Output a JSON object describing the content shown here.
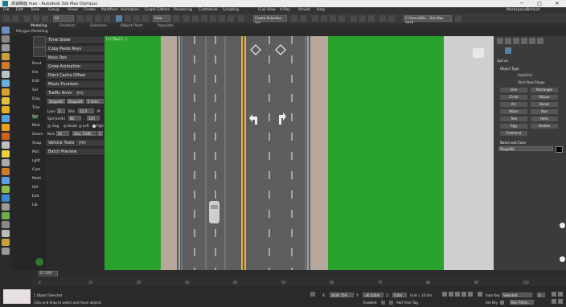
{
  "window": {
    "title": "高速路面.max - Autodesk 3ds Max Olympus",
    "min": "─",
    "max": "□",
    "close": "✕"
  },
  "menu": [
    "File",
    "Edit",
    "Tools",
    "Group",
    "Views",
    "Create",
    "Modifiers",
    "Animation",
    "Graph Editors",
    "Rendering",
    "Customize",
    "Scripting",
    "Civil View",
    "V-Ray",
    "Arnold",
    "Help"
  ],
  "workspaces": {
    "label": "Workspaces:",
    "value": "Default"
  },
  "toolbar": {
    "selection_filter": "All",
    "view_dropdown": "View",
    "selection_set": "Create Selection Set",
    "project_path": "C:\\Users\\Win...\\3ds Max 2018"
  },
  "ribbon_tabs": [
    "Modeling",
    "Freeform",
    "Selection",
    "Object Paint",
    "Populate"
  ],
  "ribbon_subtitle": "Polygon Modeling",
  "script_column": [
    "Rend",
    "File",
    "Edit",
    "Sel",
    "Disp",
    "Tran",
    "Spl",
    "Mod",
    "Geom",
    "Shap",
    "Mat",
    "Lght",
    "Cam",
    "Modl",
    "Util",
    "Extr",
    "Lib"
  ],
  "script_buttons": [
    "Time Slider",
    "Copy Paste Keys",
    "Keys Ops",
    "Grow Animation",
    "Point Cache Offset",
    "Music Fountain",
    "Traffic Anim"
  ],
  "traffic": {
    "suffix": "(m)",
    "shape_a": "Shape00",
    "shape_b": "Shape08",
    "vehicles": "0 Vehic",
    "lane_label": "Lane",
    "lane_value": "2",
    "wid_label": "Wid.",
    "wid_value": "12.0",
    "wid_unit": "M",
    "spd_label": "Spd (km/h)",
    "spd_min": "80",
    "spd_dash": "-",
    "spd_max": "120",
    "opt_gog": "Gog",
    "opt_double": "Doubl",
    "opt_left": "Left",
    "opt_right": "Righ",
    "num_label": "Num",
    "num_value": "20",
    "gen_traffic": "Gen. Traffic",
    "gen_x": "X"
  },
  "script_buttons_lower": [
    "Vehicle Trails",
    "Batch Preview"
  ],
  "vehicle_trails_suffix": "(m)",
  "viewport": {
    "label": "[+] [Top] [...]",
    "grass_color": "#29a32b",
    "asphalt_color": "#5e5e5e",
    "shoulder_color": "#b5a79b",
    "center_line_color": "#e3b33a"
  },
  "command_panel": {
    "category": "Splines",
    "object_type_title": "Object Type",
    "autogrid": "AutoGrid",
    "start_new_shape": "Start New Shape",
    "shape_buttons": [
      "Line",
      "Rectangle",
      "Circle",
      "Ellipse",
      "Arc",
      "Donut",
      "NGon",
      "Star",
      "Text",
      "Helix",
      "Egg",
      "Section",
      "Freehand"
    ],
    "name_color_title": "Name and Color",
    "object_name": "Shape00",
    "object_color": "#000000"
  },
  "timeline": {
    "frame": "0 / 100",
    "ticks": [
      "0",
      "10",
      "20",
      "30",
      "40",
      "50",
      "60",
      "70",
      "80",
      "90",
      "100"
    ]
  },
  "status": {
    "selected": "1 Object Selected",
    "prompt": "Click and drag to select and move objects",
    "x_label": "X:",
    "x_value": "2636.759",
    "y_label": "Y:",
    "y_value": "-36.026m",
    "z_label": "Z:",
    "z_value": "0.0m",
    "grid": "Grid = 10.0m",
    "enabled": "Enabled:",
    "add_time_tag": "Add Time Tag",
    "auto_key": "Auto Key",
    "selected_dropdown": "Selected",
    "set_key": "Set Key",
    "key_filters": "Key Filters...",
    "frame_field": "0"
  }
}
